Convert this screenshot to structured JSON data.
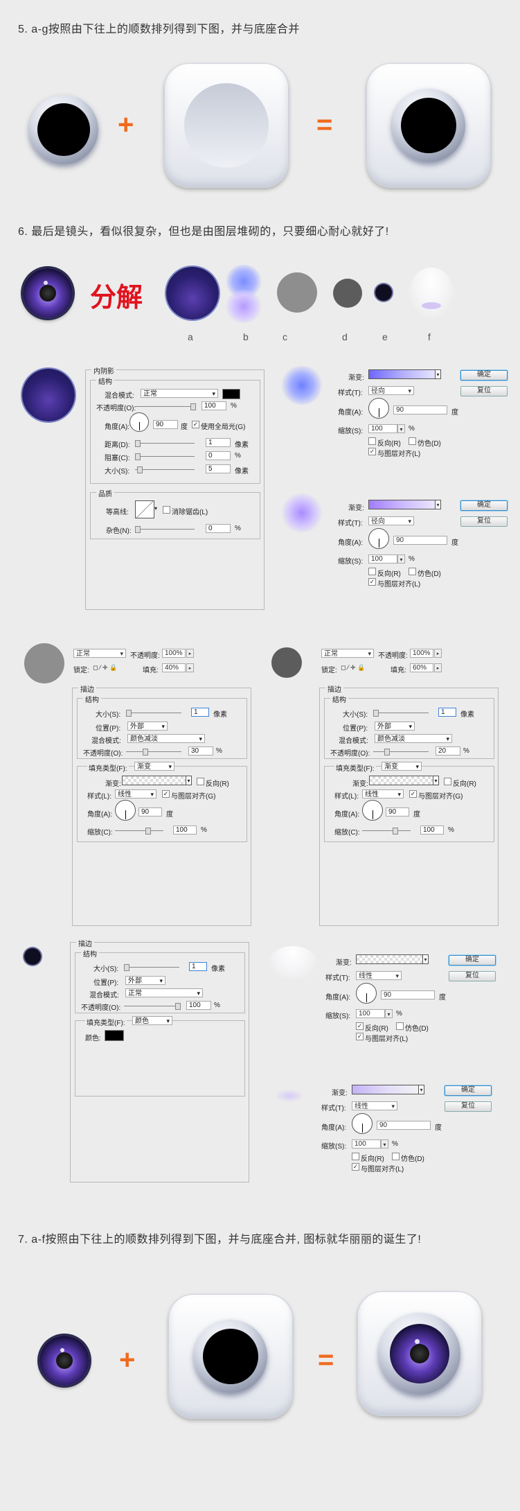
{
  "step5": {
    "heading": "5. a-g按照由下往上的顺数排列得到下图，并与底座合并"
  },
  "step6": {
    "heading": "6. 最后是镜头，看似很复杂，但也是由图层堆砌的，只要细心耐心就好了!",
    "decompose_label": "分解",
    "letters": [
      "a",
      "b",
      "c",
      "d",
      "e",
      "f"
    ]
  },
  "step7": {
    "heading": "7. a-f按照由下往上的顺数排列得到下图，并与底座合并, 图标就华丽丽的诞生了!"
  },
  "ops": {
    "plus": "+",
    "equals": "="
  },
  "colors": {
    "accent": "#f06a1e",
    "decompose": "#e0121e"
  },
  "inner_shadow": {
    "title": "内阴影",
    "structure": "结构",
    "blend_label": "混合模式:",
    "blend_value": "正常",
    "opacity_label": "不透明度(O):",
    "opacity_value": "100",
    "pct": "%",
    "angle_label": "角度(A):",
    "angle_value": "90",
    "deg": "度",
    "global_light": "使用全局光(G)",
    "distance_label": "距离(D):",
    "distance_value": "1",
    "px": "像素",
    "choke_label": "阻塞(C):",
    "choke_value": "0",
    "size_label": "大小(S):",
    "size_value": "5",
    "quality": "品质",
    "contour_label": "等高线:",
    "antialias": "消除锯齿(L)",
    "noise_label": "杂色(N):",
    "noise_value": "0"
  },
  "gradient_dialogs": {
    "gradient_label": "渐变:",
    "style_label": "样式(T):",
    "angle_label": "角度(A):",
    "scale_label": "缩放(S):",
    "reverse": "反向(R)",
    "dither": "仿色(D)",
    "align": "与图层对齐(L)",
    "ok": "确定",
    "reset": "复位",
    "deg": "度",
    "pct": "%",
    "d1": {
      "style": "径向",
      "angle": "90",
      "scale": "100"
    },
    "d2": {
      "style": "径向",
      "angle": "90",
      "scale": "100"
    },
    "d3": {
      "style": "线性",
      "angle": "90",
      "scale": "100"
    },
    "d4": {
      "style": "线性",
      "angle": "90",
      "scale": "100"
    }
  },
  "layers": {
    "mode": "正常",
    "opacity_label": "不透明度:",
    "lock_label": "锁定:",
    "fill_label": "填充:",
    "left": {
      "opacity": "100%",
      "fill": "40%"
    },
    "right": {
      "opacity": "100%",
      "fill": "60%"
    }
  },
  "stroke": {
    "title": "描边",
    "structure": "结构",
    "size_label": "大小(S):",
    "size_value": "1",
    "px": "像素",
    "position_label": "位置(P):",
    "position_value": "外部",
    "blend_label": "混合模式:",
    "opacity_label": "不透明度(O):",
    "pct": "%",
    "fill_type_label": "填充类型(F):",
    "gradient_label": "渐变:",
    "reverse": "反向(R)",
    "style_label": "样式(L):",
    "align": "与图层对齐(G)",
    "angle_label": "角度(A):",
    "angle_value": "90",
    "deg": "度",
    "scale_label": "缩放(C):",
    "scale_value": "100",
    "color_label": "颜色:",
    "s1": {
      "blend": "颜色减淡",
      "opacity": "30",
      "fill_type": "渐变",
      "style": "线性"
    },
    "s2": {
      "blend": "颜色减淡",
      "opacity": "20",
      "fill_type": "渐变",
      "style": "线性"
    },
    "s3": {
      "blend": "正常",
      "opacity": "100",
      "fill_type": "颜色"
    }
  }
}
